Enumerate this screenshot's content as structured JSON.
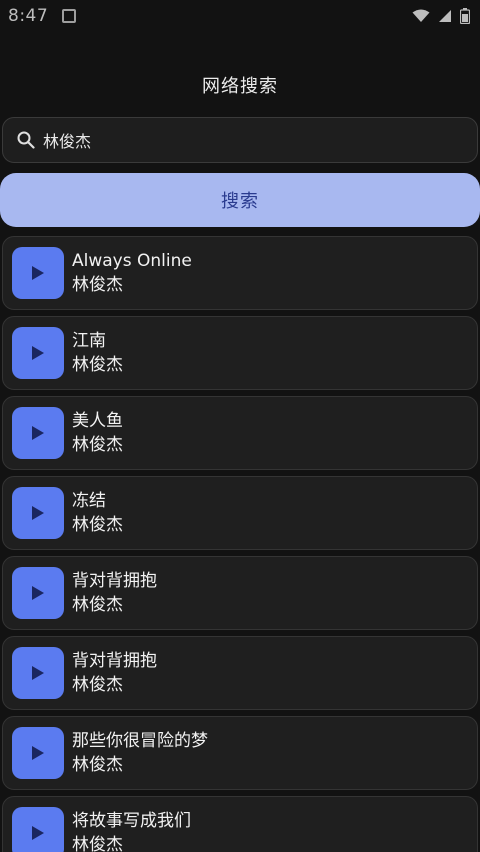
{
  "status_bar": {
    "time": "8:47",
    "icons": [
      "notification-icon",
      "wifi-icon",
      "signal-icon",
      "battery-icon"
    ]
  },
  "header": {
    "title": "网络搜索"
  },
  "search": {
    "value": "林俊杰",
    "placeholder": "",
    "button_label": "搜索"
  },
  "results": [
    {
      "title": "Always Online",
      "artist": "林俊杰"
    },
    {
      "title": "江南",
      "artist": "林俊杰"
    },
    {
      "title": "美人鱼",
      "artist": "林俊杰"
    },
    {
      "title": "冻结",
      "artist": "林俊杰"
    },
    {
      "title": "背对背拥抱",
      "artist": "林俊杰"
    },
    {
      "title": "背对背拥抱",
      "artist": "林俊杰"
    },
    {
      "title": "那些你很冒险的梦",
      "artist": "林俊杰"
    },
    {
      "title": "将故事写成我们",
      "artist": "林俊杰"
    }
  ],
  "colors": {
    "background": "#121212",
    "card": "#1f1f1f",
    "accent": "#5b7bf0",
    "button": "#a8b8f0",
    "button_text": "#2a3b8f"
  }
}
